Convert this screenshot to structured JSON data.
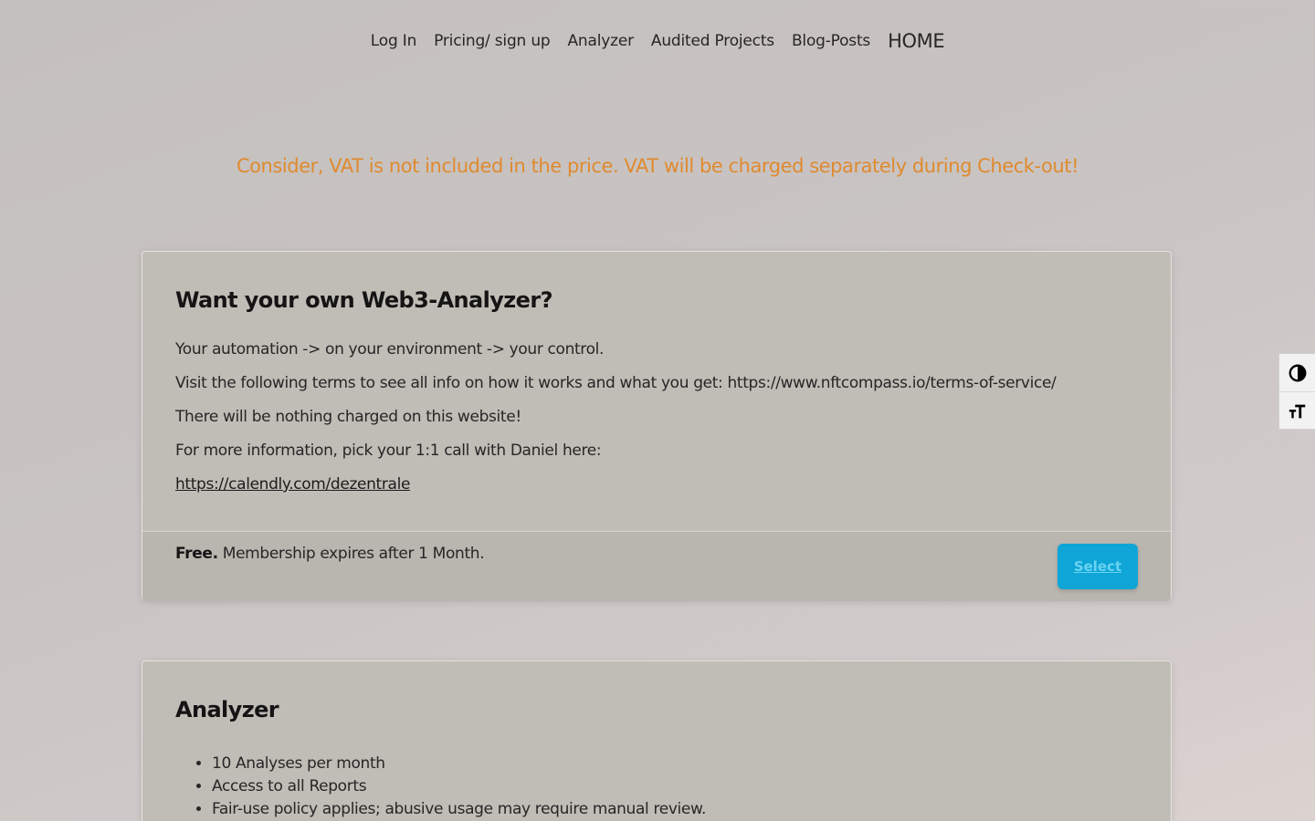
{
  "nav": {
    "items": [
      {
        "label": "Log In"
      },
      {
        "label": "Pricing/ sign up"
      },
      {
        "label": "Analyzer"
      },
      {
        "label": "Audited Projects"
      },
      {
        "label": "Blog-Posts"
      },
      {
        "label": "HOME"
      }
    ]
  },
  "notice": {
    "text": "Consider, VAT is not included in the price. VAT will be charged separately during Check-out!",
    "color": "#e08a2e"
  },
  "plans": [
    {
      "title": "Want your own Web3-Analyzer?",
      "paragraphs": [
        "Your automation -> on your environment -> your control.",
        "Visit the following terms to see all info on how it works and what you get: https://www.nftcompass.io/terms-of-service/",
        "There will be nothing charged on this website!",
        "For more information, pick your 1:1 call with Daniel here:"
      ],
      "link": "https://calendly.com/dezentrale",
      "price_label": "Free.",
      "price_detail": "Membership expires after 1 Month.",
      "select_label": "Select"
    },
    {
      "title": "Analyzer",
      "features": [
        "10 Analyses per month",
        "Access to all Reports",
        "Fair-use policy applies; abusive usage may require manual review."
      ]
    }
  ],
  "accessibility": {
    "contrast_icon": "contrast-icon",
    "font_size_icon": "font-size-icon"
  },
  "colors": {
    "accent": "#0fa5d6",
    "notice": "#e08a2e"
  }
}
